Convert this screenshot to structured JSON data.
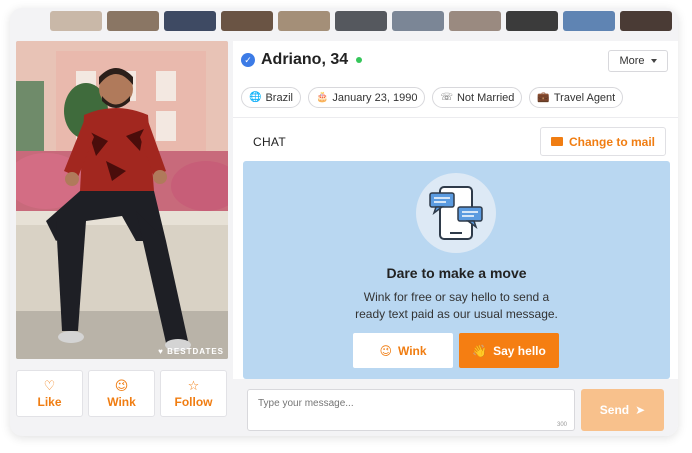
{
  "profile": {
    "name": "Adriano, 34",
    "more_label": "More",
    "tags": [
      {
        "icon": "globe-icon",
        "label": "Brazil"
      },
      {
        "icon": "cake-icon",
        "label": "January 23, 1990"
      },
      {
        "icon": "phone-icon",
        "label": "Not Married"
      },
      {
        "icon": "briefcase-icon",
        "label": "Travel Agent"
      }
    ],
    "photo_watermark": "BESTDATES"
  },
  "actions": [
    {
      "icon": "heart-icon",
      "label": "Like"
    },
    {
      "icon": "smile-icon",
      "label": "Wink"
    },
    {
      "icon": "star-icon",
      "label": "Follow"
    }
  ],
  "chat": {
    "label": "CHAT",
    "mail_button": "Change to mail",
    "title": "Dare to make a move",
    "subtitle_line1": "Wink for free or say hello to send a",
    "subtitle_line2": "ready text paid as our usual message.",
    "wink_button": "Wink",
    "hello_button": "Say hello",
    "input_placeholder": "Type your message...",
    "char_counter": "300",
    "send_button": "Send"
  },
  "colors": {
    "accent": "#f07d12",
    "chat_bg": "#b9d7f1",
    "verified": "#3c7be6",
    "online": "#35c65a"
  }
}
